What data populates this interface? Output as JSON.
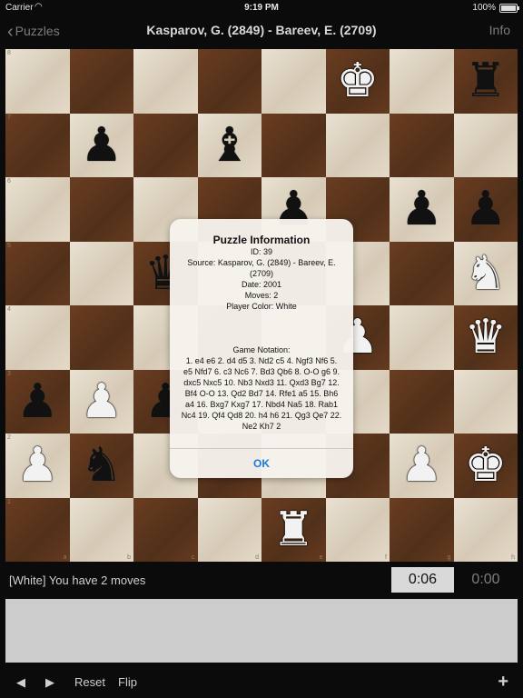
{
  "status_bar": {
    "carrier": "Carrier",
    "time": "9:19 PM",
    "battery": "100%"
  },
  "nav": {
    "back_label": "Puzzles",
    "title": "Kasparov, G. (2849) - Bareev, E. (2709)",
    "info_label": "Info"
  },
  "board": {
    "ranks": [
      "8",
      "7",
      "6",
      "5",
      "4",
      "3",
      "2",
      "1"
    ],
    "files": [
      "a",
      "b",
      "c",
      "d",
      "e",
      "f",
      "g",
      "h"
    ],
    "squares": [
      [
        "",
        "",
        "",
        "",
        "",
        "wk",
        "",
        "br"
      ],
      [
        "",
        "bp",
        "",
        "bb",
        "",
        "",
        "",
        ""
      ],
      [
        "",
        "",
        "",
        "",
        "bp",
        "",
        "bp",
        "bp"
      ],
      [
        "",
        "",
        "bq",
        "",
        "",
        "",
        "",
        "wn"
      ],
      [
        "",
        "",
        "",
        "",
        "",
        "wp",
        "",
        "wq"
      ],
      [
        "bp",
        "wp",
        "bp",
        "",
        "",
        "",
        "",
        ""
      ],
      [
        "wp",
        "bn",
        "",
        "",
        "",
        "",
        "wp",
        "wk"
      ],
      [
        "",
        "",
        "",
        "",
        "wr",
        "",
        "",
        ""
      ]
    ],
    "piece_glyphs": {
      "k": "♚",
      "q": "♛",
      "r": "♜",
      "b": "♝",
      "n": "♞",
      "p": "♟"
    }
  },
  "game": {
    "status_text": "[White] You have 2 moves",
    "clock_active": "0:06",
    "clock_inactive": "0:00"
  },
  "toolbar": {
    "prev": "◀",
    "next": "▶",
    "reset": "Reset",
    "flip": "Flip",
    "add": "+"
  },
  "dialog": {
    "title": "Puzzle Information",
    "id": "ID: 39",
    "source": "Source: Kasparov, G. (2849) - Bareev, E. (2709)",
    "date": "Date: 2001",
    "moves": "Moves: 2",
    "player_color": "Player Color: White",
    "notation_header": "Game Notation:",
    "notation": "1. e4 e6 2. d4 d5 3. Nd2 c5 4. Ngf3 Nf6 5. e5 Nfd7 6. c3 Nc6 7. Bd3 Qb6 8. O-O g6 9. dxc5 Nxc5 10. Nb3 Nxd3 11. Qxd3 Bg7 12. Bf4 O-O 13. Qd2 Bd7 14. Rfe1 a5 15. Bh6 a4 16. Bxg7 Kxg7 17. Nbd4 Na5 18. Rab1 Nc4 19. Qf4 Qd8 20. h4 h6 21. Qg3 Qe7 22. Ne2 Kh7 2",
    "ok_label": "OK"
  }
}
